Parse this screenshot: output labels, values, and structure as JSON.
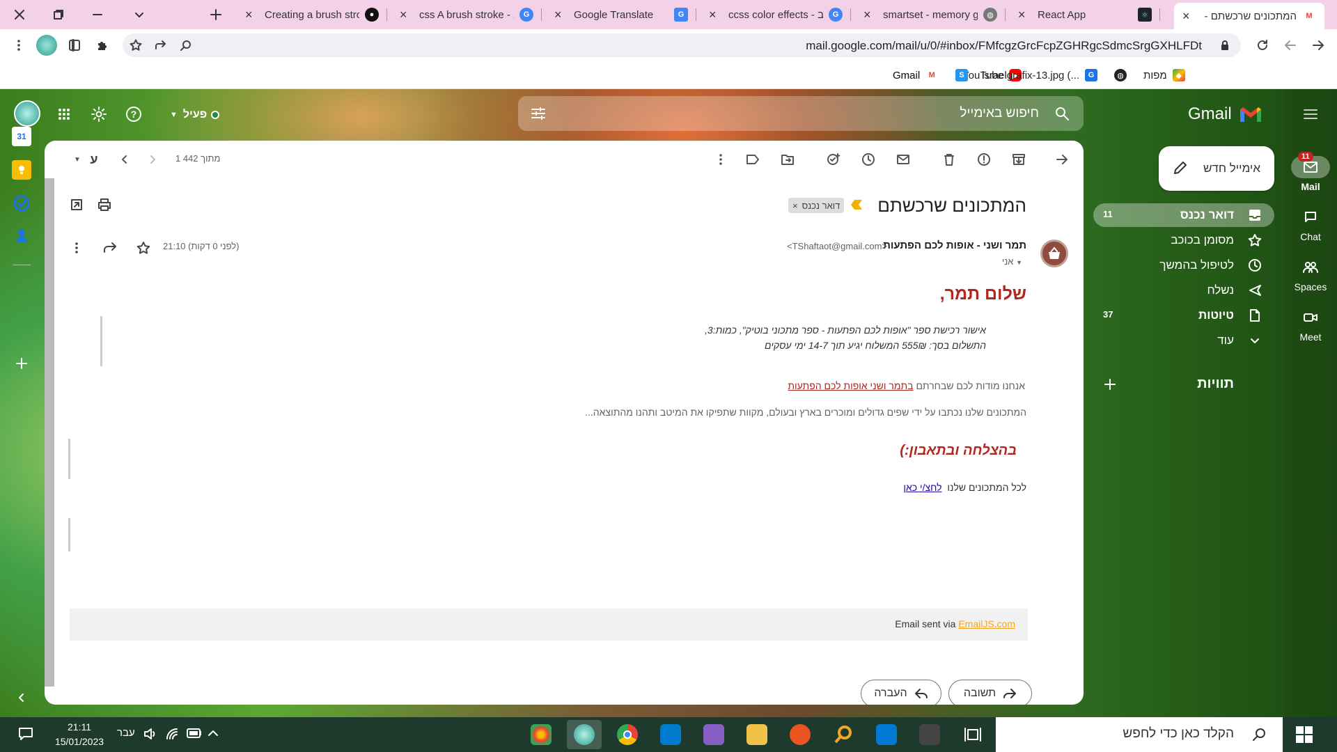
{
  "browser": {
    "tabs": [
      {
        "label": "המתכונים שרכשתם -",
        "active": true,
        "favicon": "gmail-icon"
      },
      {
        "label": "React App",
        "favicon": "react-icon"
      },
      {
        "label": "smartset - memory ga",
        "favicon": "globe-icon"
      },
      {
        "label": "ccss color effects - ב",
        "favicon": "google-icon"
      },
      {
        "label": "Google Translate",
        "favicon": "translate-icon"
      },
      {
        "label": "css A brush stroke - ב",
        "favicon": "google-icon"
      },
      {
        "label": "Creating a brush strol",
        "favicon": "github-icon"
      }
    ],
    "url": "mail.google.com/mail/u/0/#inbox/FMfcgzGrcFcpZGHRgcSdmcSrgGXHLFDt",
    "bookmarks": [
      {
        "label": "Gmail",
        "icon": "gmail-icon"
      },
      {
        "label": "YouTube",
        "icon": "youtube-icon"
      },
      {
        "label": "מפות",
        "icon": "maps-icon"
      },
      {
        "label": "",
        "icon": "globe-icon"
      },
      {
        "label": "israelgrafix-13.jpg (...",
        "icon": "image-icon"
      },
      {
        "label": "",
        "icon": "s-icon"
      },
      {
        "label": "Gmail",
        "icon": "gmail-icon"
      }
    ]
  },
  "gmail": {
    "logo": "Gmail",
    "search_placeholder": "חיפוש באימייל",
    "status": "פעיל",
    "compose_label": "אימייל חדש",
    "nav": [
      {
        "label": "Mail",
        "badge": "11"
      },
      {
        "label": "Chat"
      },
      {
        "label": "Spaces"
      },
      {
        "label": "Meet"
      }
    ],
    "folders": [
      {
        "label": "דואר נכנס",
        "count": "11",
        "icon": "inbox-icon",
        "active": true
      },
      {
        "label": "מסומן בכוכב",
        "count": "",
        "icon": "star-icon"
      },
      {
        "label": "לטיפול בהמשך",
        "count": "",
        "icon": "clock-icon"
      },
      {
        "label": "נשלח",
        "count": "",
        "icon": "send-icon"
      },
      {
        "label": "טיוטות",
        "count": "37",
        "icon": "draft-icon"
      },
      {
        "label": "עוד",
        "count": "",
        "icon": "chevron-down-icon"
      }
    ],
    "labels_header": "תוויות",
    "toolbar": {
      "pager": "1 מתוך 442",
      "lang": "ע"
    },
    "email": {
      "subject": "המתכונים שרכשתם",
      "label_chip": "דואר נכנס",
      "sender_name": "תמר ושני - אופות לכם הפתעות",
      "sender_email": "<TShaftaot@gmail.com>",
      "to": "אני",
      "time": "21:10 (לפני 0 דקות)",
      "greeting": "שלום תמר,",
      "line1": "אישור רכישת ספר \"אופות לכם הפתעות - ספר מתכוני בוטיק\", כמות:3,",
      "line2": "התשלום בסך: 555₪ המשלוח יגיע תוך 14-7 ימי עסקים",
      "thanks_prefix": "אנחנו מודות לכם שבחרתם",
      "thanks_link": "בתמר ושני אופות לכם הפתעות",
      "recipes_line": "המתכונים שלנו נכתבו על ידי שפים גדולים ומוכרים בארץ ובעולם, מקוות שתפיקו את המיטב ותהנו מהתוצאה...",
      "blessing": "בהצלחה ובתאבון:)",
      "all_recipes_prefix": "לכל המתכונים שלנו",
      "all_recipes_link": "לחצ/י כאן",
      "footer_prefix": "Email sent via",
      "footer_link": "EmailJS.com",
      "reply_label": "תשובה",
      "forward_label": "העברה"
    }
  },
  "taskbar": {
    "search_placeholder": "הקלד כאן כדי לחפש",
    "time": "21:11",
    "date": "15/01/2023",
    "lang": "עבר"
  },
  "colors": {
    "tabstrip": "#f3d1e8",
    "red_text": "#b3261e",
    "link": "#1a0dab",
    "emailjs": "#f4a623"
  }
}
